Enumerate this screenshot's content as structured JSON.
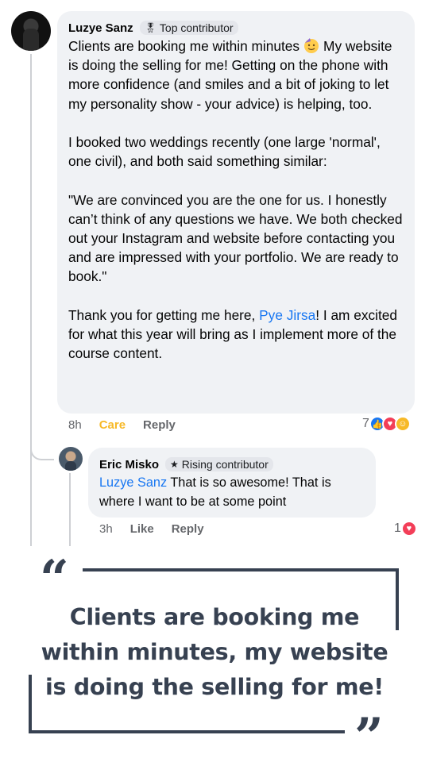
{
  "comment": {
    "author": "Luzye Sanz",
    "badge": "Top contributor",
    "badge_icon": "medal-icon",
    "paragraphs": {
      "p1_before_emoji": "Clients are booking me within minutes",
      "p1_emoji": "partying-face-emoji",
      "p1_after_emoji": "My website is doing the selling for me!  Getting on the phone with more confidence (and smiles and a bit of joking to let my personality show - your advice) is helping, too.",
      "p2": "I booked two weddings recently (one large 'normal', one civil), and both said something similar:",
      "p3": "\"We are convinced you are the one for us. I honestly can’t think of any questions we have. We both checked out your Instagram and website before contacting you and are impressed with your portfolio. We are ready to book.\"",
      "p4_before_mention": "Thank you for getting me here, ",
      "p4_mention": "Pye Jirsa",
      "p4_after_mention": "!  I am excited for what this year will bring as I implement more of the course content."
    },
    "time": "8h",
    "reaction_label": "Care",
    "reply_label": "Reply",
    "reaction_count": "7",
    "reactions": [
      "like",
      "love",
      "care"
    ]
  },
  "reply": {
    "author": "Eric Misko",
    "badge": "Rising contributor",
    "badge_icon": "star-icon",
    "mention": "Luzye Sanz",
    "text": " That is so awesome! That is where I want to be at some point",
    "time": "3h",
    "like_label": "Like",
    "reply_label": "Reply",
    "reaction_count": "1",
    "reactions": [
      "love"
    ]
  },
  "quote": {
    "open_mark": "“",
    "close_mark": "”",
    "text": "Clients are booking me within minutes, my website is doing the selling for me!"
  },
  "colors": {
    "bubble": "#f0f2f5",
    "mention": "#1877f2",
    "care": "#f7b928",
    "quote": "#374151"
  }
}
